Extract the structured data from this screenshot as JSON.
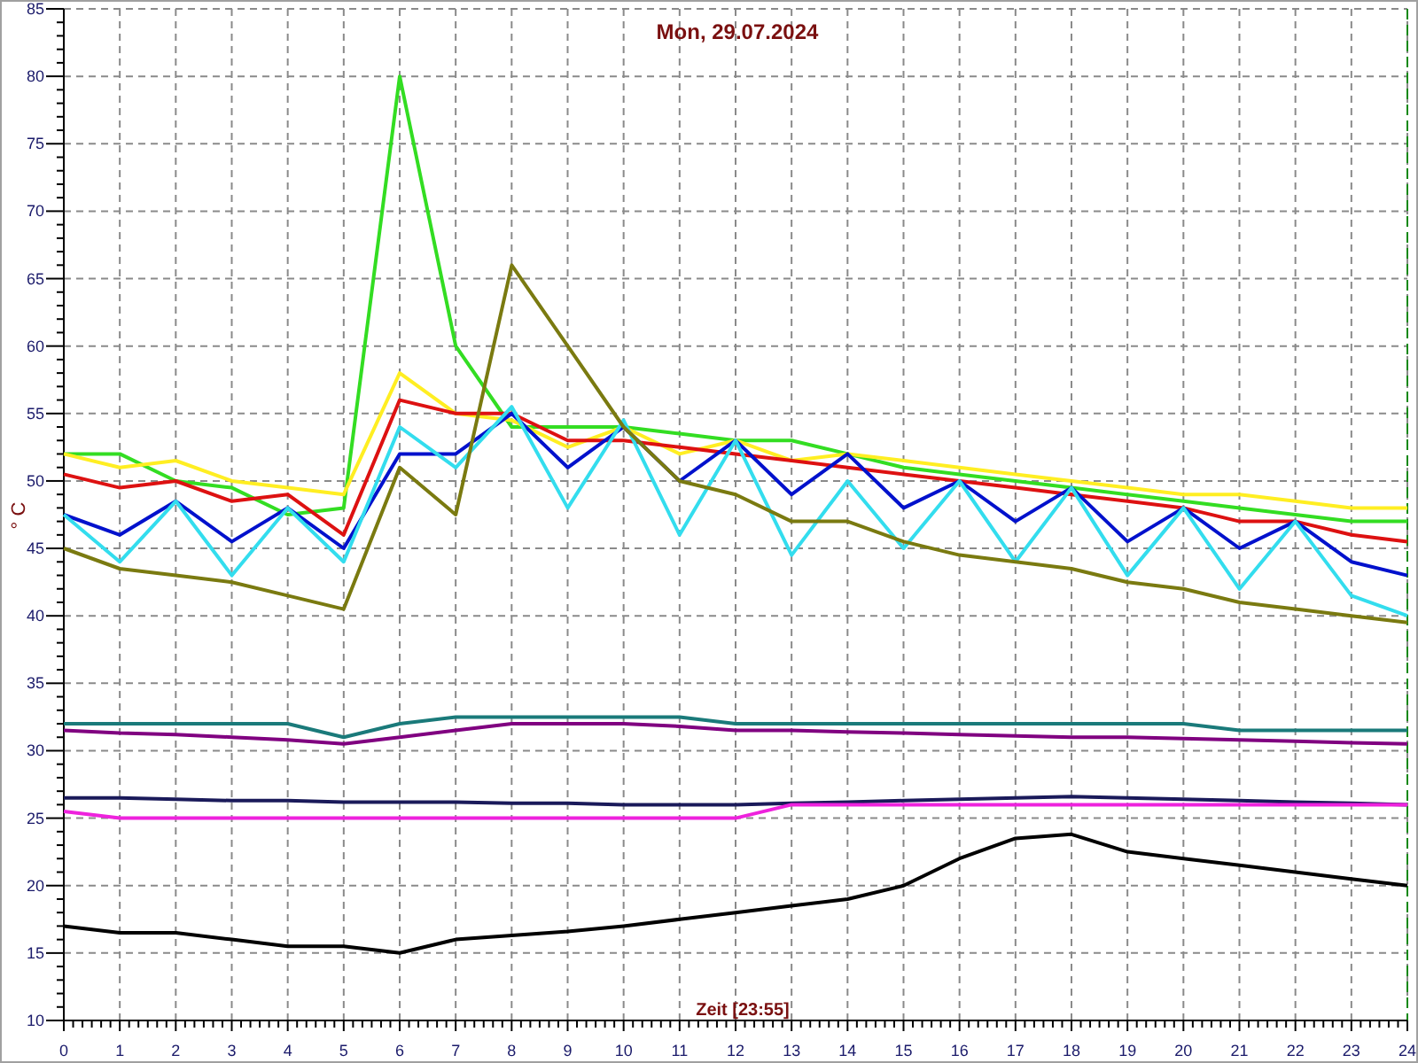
{
  "chart_data": {
    "type": "line",
    "title": "Mon, 29.07.2024",
    "xlabel": "Zeit [23:55]",
    "ylabel": "° C",
    "x": [
      0,
      1,
      2,
      3,
      4,
      5,
      6,
      7,
      8,
      9,
      10,
      11,
      12,
      13,
      14,
      15,
      16,
      17,
      18,
      19,
      20,
      21,
      22,
      23,
      24
    ],
    "grid": true,
    "xlim": [
      0,
      24
    ],
    "ylim": [
      10,
      85
    ],
    "xticks": [
      0,
      1,
      2,
      3,
      4,
      5,
      6,
      7,
      8,
      9,
      10,
      11,
      12,
      13,
      14,
      15,
      16,
      17,
      18,
      19,
      20,
      21,
      22,
      23,
      24
    ],
    "yticks": [
      10,
      15,
      20,
      25,
      30,
      35,
      40,
      45,
      50,
      55,
      60,
      65,
      70,
      75,
      80,
      85
    ],
    "series": [
      {
        "color": "#33dd22",
        "values": [
          52,
          52,
          50,
          49.5,
          47.5,
          48,
          80,
          60,
          54,
          54,
          54,
          53.5,
          53,
          53,
          52,
          51,
          50.5,
          50,
          49.5,
          49,
          48.5,
          48,
          47.5,
          47,
          47
        ]
      },
      {
        "color": "#ffee22",
        "values": [
          52,
          51,
          51.5,
          50,
          49.5,
          49,
          58,
          55,
          54.5,
          52.5,
          54,
          52,
          53,
          51.5,
          52,
          51.5,
          51,
          50.5,
          50,
          49.5,
          49,
          49,
          48.5,
          48,
          48
        ]
      },
      {
        "color": "#dd1111",
        "values": [
          50.5,
          49.5,
          50,
          48.5,
          49,
          46,
          56,
          55,
          55,
          53,
          53,
          52.5,
          52,
          51.5,
          51,
          50.5,
          50,
          49.5,
          49,
          48.5,
          48,
          47,
          47,
          46,
          45.5
        ]
      },
      {
        "color": "#0011cc",
        "values": [
          47.5,
          46,
          48.5,
          45.5,
          48,
          45,
          52,
          52,
          55,
          51,
          54,
          50,
          53,
          49,
          52,
          48,
          50,
          47,
          49.5,
          45.5,
          48,
          45,
          47,
          44,
          43
        ]
      },
      {
        "color": "#33ddee",
        "values": [
          47.5,
          44,
          48.5,
          43,
          48,
          44,
          54,
          51,
          55.5,
          48,
          54.5,
          46,
          53,
          44.5,
          50,
          45,
          50,
          44,
          49.5,
          43,
          48,
          42,
          47,
          41.5,
          40
        ]
      },
      {
        "color": "#7a7a10",
        "values": [
          45,
          43.5,
          43,
          42.5,
          41.5,
          40.5,
          51,
          47.5,
          66,
          60,
          54,
          50,
          49,
          47,
          47,
          45.5,
          44.5,
          44,
          43.5,
          42.5,
          42,
          41,
          40.5,
          40,
          39.5
        ]
      },
      {
        "color": "#1a7a7a",
        "values": [
          32,
          32,
          32,
          32,
          32,
          31,
          32,
          32.5,
          32.5,
          32.5,
          32.5,
          32.5,
          32,
          32,
          32,
          32,
          32,
          32,
          32,
          32,
          32,
          31.5,
          31.5,
          31.5,
          31.5
        ]
      },
      {
        "color": "#800080",
        "values": [
          31.5,
          31.3,
          31.2,
          31,
          30.8,
          30.5,
          31,
          31.5,
          32,
          32,
          32,
          31.8,
          31.5,
          31.5,
          31.4,
          31.3,
          31.2,
          31.1,
          31,
          31,
          30.9,
          30.8,
          30.7,
          30.6,
          30.5
        ]
      },
      {
        "color": "#1a1a5a",
        "values": [
          26.5,
          26.5,
          26.4,
          26.3,
          26.3,
          26.2,
          26.2,
          26.2,
          26.1,
          26.1,
          26,
          26,
          26,
          26.1,
          26.2,
          26.3,
          26.4,
          26.5,
          26.6,
          26.5,
          26.4,
          26.3,
          26.2,
          26.1,
          26
        ]
      },
      {
        "color": "#ee22dd",
        "values": [
          25.5,
          25,
          25,
          25,
          25,
          25,
          25,
          25,
          25,
          25,
          25,
          25,
          25,
          26,
          26,
          26,
          26,
          26,
          26,
          26,
          26,
          26,
          26,
          26,
          26
        ]
      },
      {
        "color": "#000000",
        "values": [
          17,
          16.5,
          16.5,
          16,
          15.5,
          15.5,
          15,
          16,
          16.3,
          16.6,
          17,
          17.5,
          18,
          18.5,
          19,
          20,
          22,
          23.5,
          23.8,
          22.5,
          22,
          21.5,
          21,
          20.5,
          20
        ]
      }
    ]
  }
}
